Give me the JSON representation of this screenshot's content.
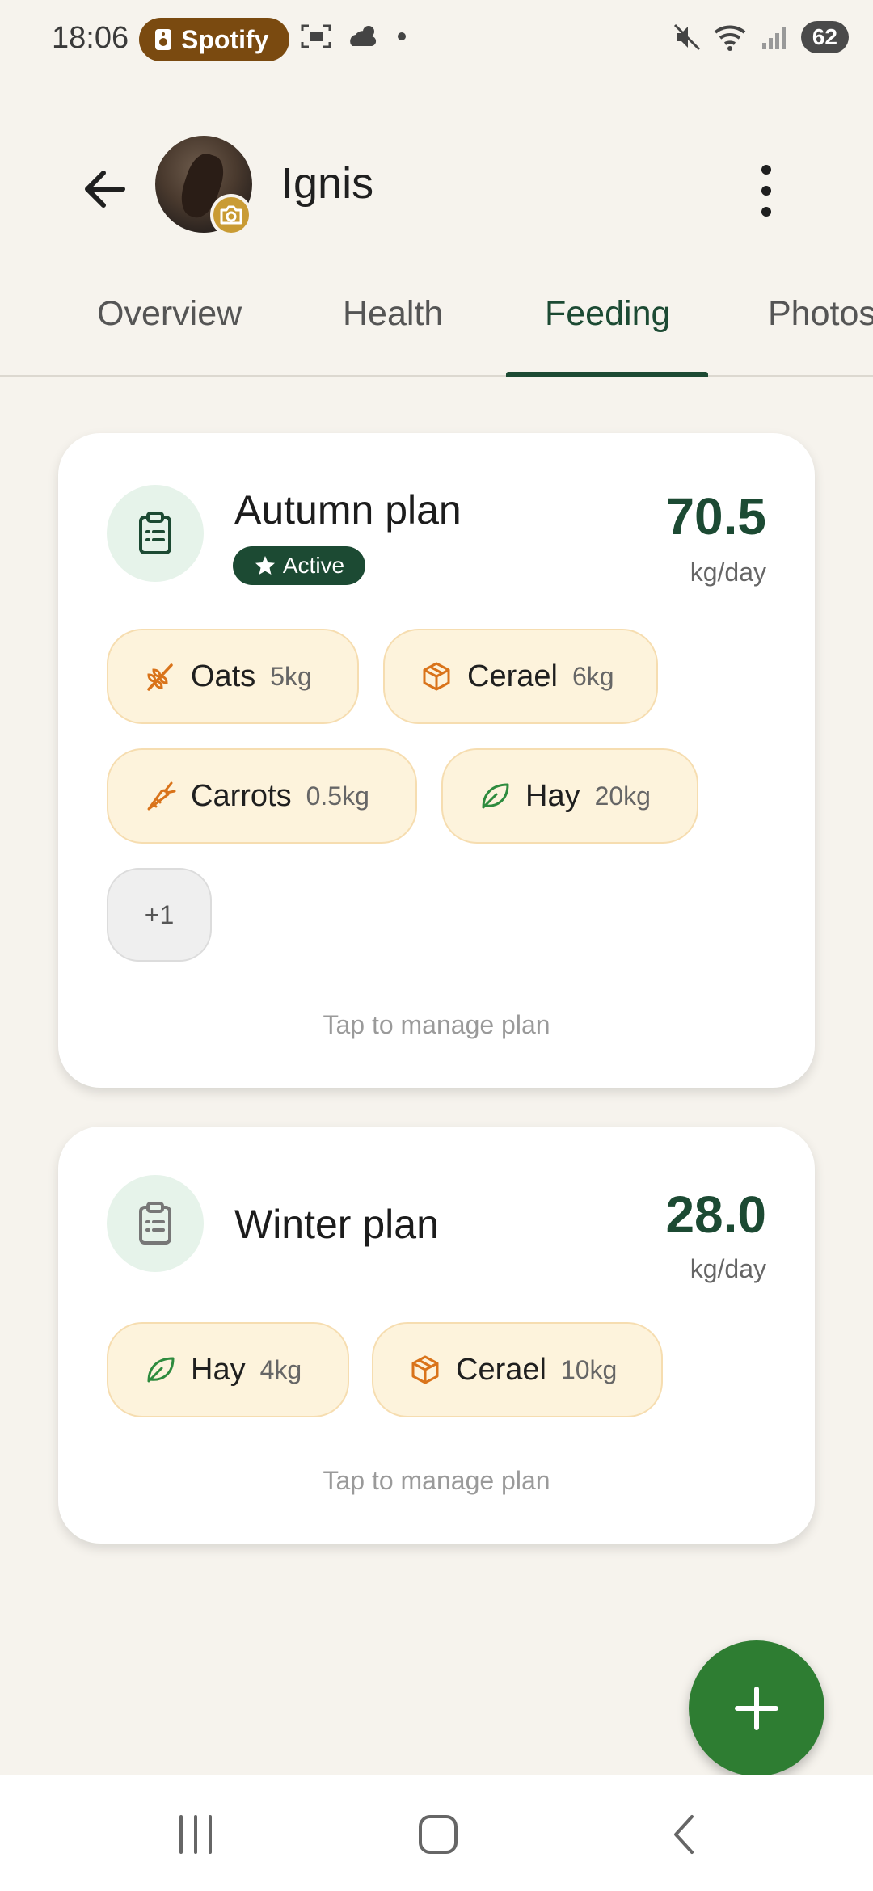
{
  "status_bar": {
    "time": "18:06",
    "spotify_label": "Spotify",
    "battery": "62"
  },
  "header": {
    "horse_name": "Ignis"
  },
  "tabs": [
    {
      "label": "Overview"
    },
    {
      "label": "Health"
    },
    {
      "label": "Feeding",
      "active": true
    },
    {
      "label": "Photos"
    }
  ],
  "plans": [
    {
      "title": "Autumn plan",
      "badge": "Active",
      "total": "70.5",
      "unit": "kg/day",
      "items": [
        {
          "name": "Oats",
          "qty": "5kg",
          "icon": "wheat-icon"
        },
        {
          "name": "Cerael",
          "qty": "6kg",
          "icon": "box-icon"
        },
        {
          "name": "Carrots",
          "qty": "0.5kg",
          "icon": "carrot-icon"
        },
        {
          "name": "Hay",
          "qty": "20kg",
          "icon": "leaf-icon"
        }
      ],
      "more": "+1",
      "hint": "Tap to manage plan"
    },
    {
      "title": "Winter plan",
      "total": "28.0",
      "unit": "kg/day",
      "items": [
        {
          "name": "Hay",
          "qty": "4kg",
          "icon": "leaf-icon"
        },
        {
          "name": "Cerael",
          "qty": "10kg",
          "icon": "box-icon"
        }
      ],
      "hint": "Tap to manage plan"
    }
  ],
  "colors": {
    "accent": "#1c4a33",
    "fab": "#2e7d32",
    "chip_bg": "#fdf3dc",
    "background": "#f6f3ed"
  }
}
